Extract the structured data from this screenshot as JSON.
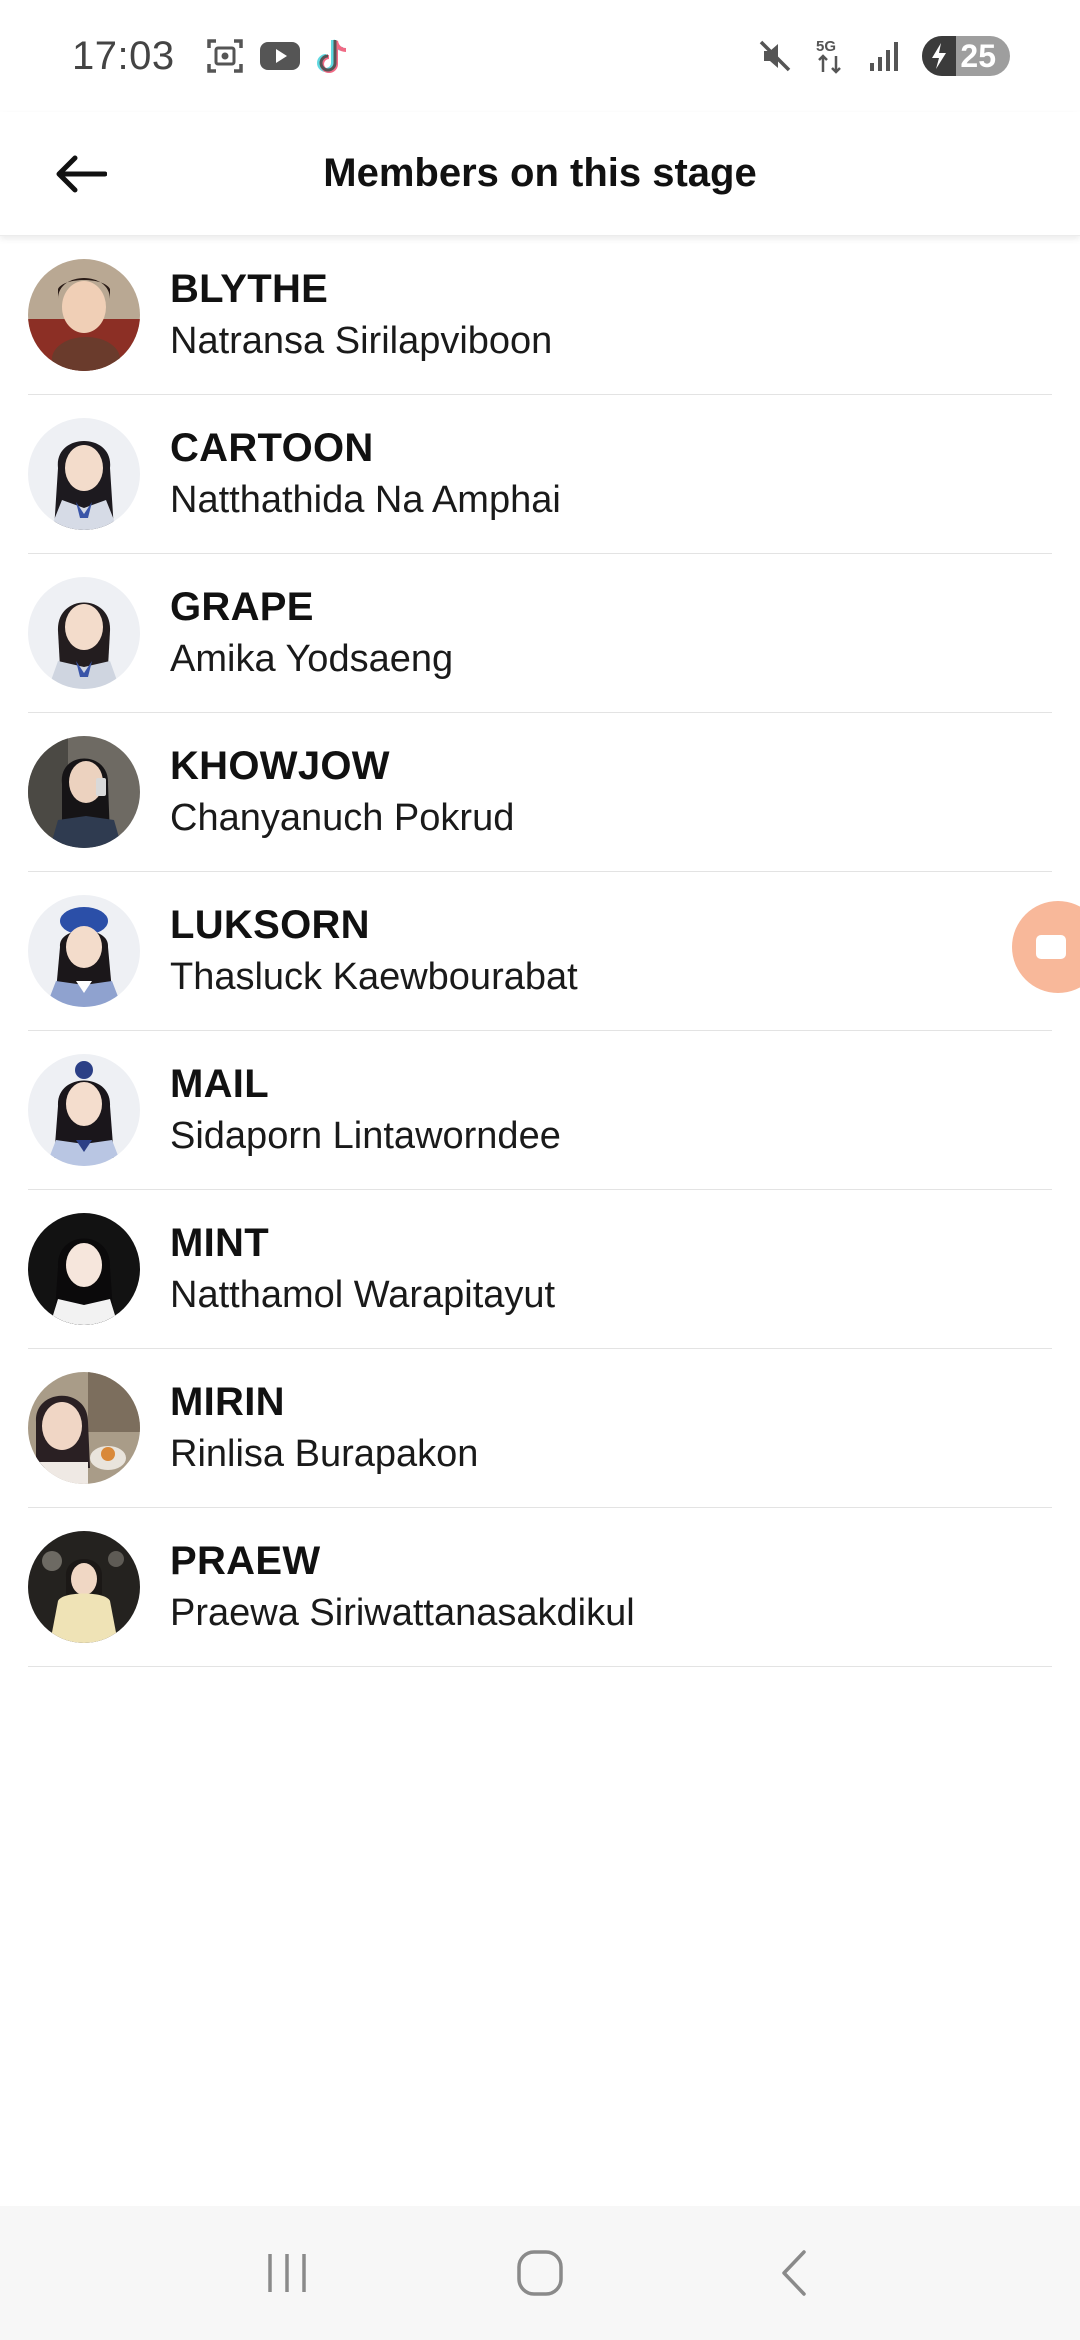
{
  "status_bar": {
    "time": "17:03",
    "left_icons": [
      "screenshot-icon",
      "youtube-icon",
      "tiktok-icon"
    ],
    "right_icons": [
      "mute-icon",
      "5g-icon",
      "signal-icon"
    ],
    "network_label": "5G",
    "battery_level": "25",
    "battery_charging": true
  },
  "header": {
    "title": "Members on this stage",
    "back_icon": "arrow-left-icon"
  },
  "members": [
    {
      "nickname": "BLYTHE",
      "full_name": "Natransa Sirilapviboon"
    },
    {
      "nickname": "CARTOON",
      "full_name": "Natthathida Na Amphai"
    },
    {
      "nickname": "GRAPE",
      "full_name": "Amika Yodsaeng"
    },
    {
      "nickname": "KHOWJOW",
      "full_name": "Chanyanuch Pokrud"
    },
    {
      "nickname": "LUKSORN",
      "full_name": "Thasluck Kaewbourabat"
    },
    {
      "nickname": "MAIL",
      "full_name": "Sidaporn Lintaworndee"
    },
    {
      "nickname": "MINT",
      "full_name": "Natthamol Warapitayut"
    },
    {
      "nickname": "MIRIN",
      "full_name": "Rinlisa Burapakon"
    },
    {
      "nickname": "PRAEW",
      "full_name": "Praewa Siriwattanasakdikul"
    }
  ],
  "floating_button": {
    "icon": "video-camera-icon",
    "color": "#f8b89a"
  },
  "nav_bar": {
    "buttons": [
      "recent-apps-icon",
      "home-icon",
      "back-icon"
    ]
  },
  "colors": {
    "divider": "#e3e3e3",
    "text": "#111111",
    "nav_background": "#f7f7f7"
  }
}
